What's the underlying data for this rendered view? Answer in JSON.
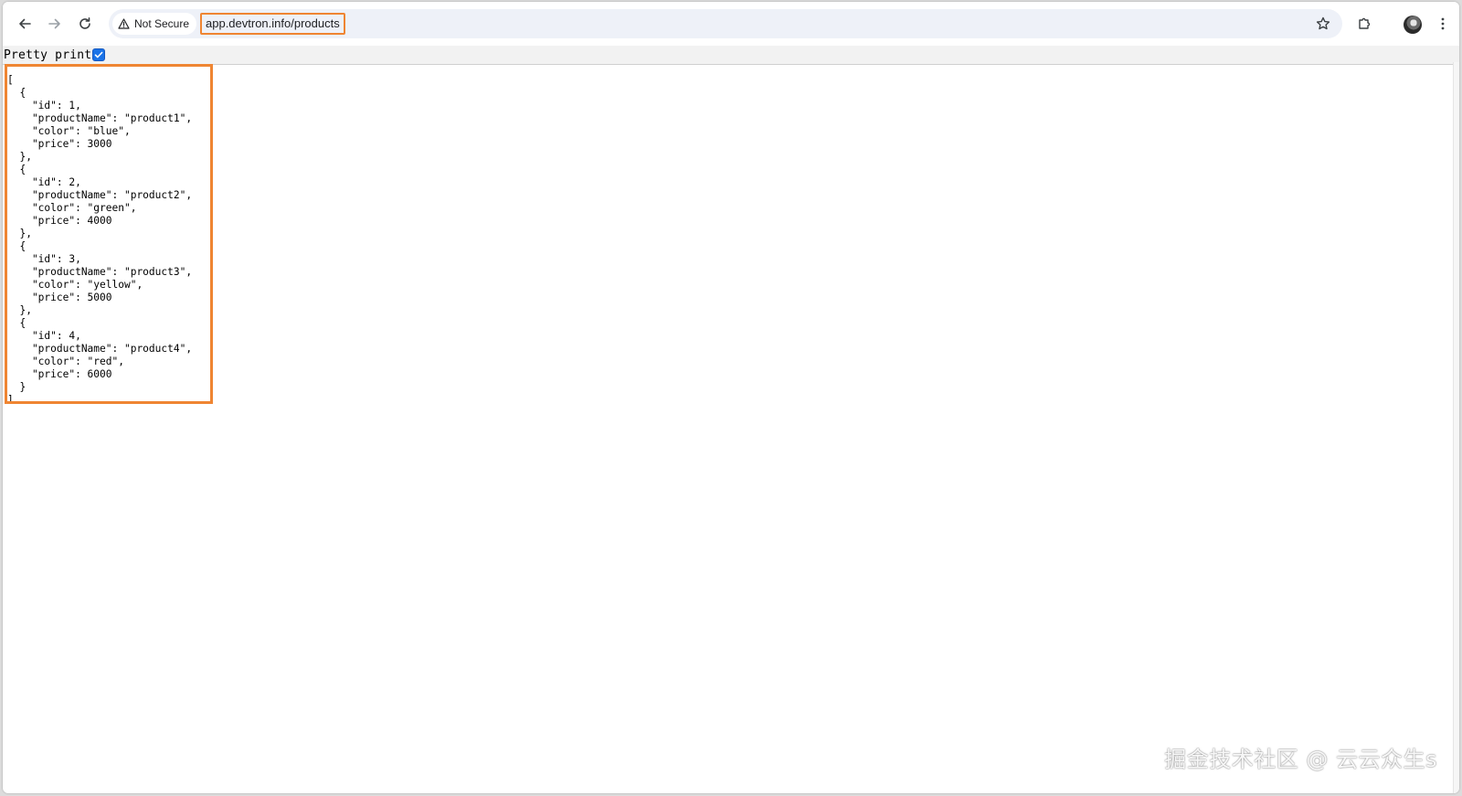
{
  "browser": {
    "security_label": "Not Secure",
    "url": "app.devtron.info/products",
    "icons": {
      "back": "arrow-left-icon",
      "forward": "arrow-right-icon",
      "reload": "reload-icon",
      "warning": "warning-triangle-icon",
      "bookmark": "star-icon",
      "extensions": "puzzle-icon",
      "profile": "avatar",
      "menu": "kebab-menu-icon"
    },
    "highlight_color": "#ef8532"
  },
  "viewer": {
    "pretty_print_label": "Pretty print",
    "pretty_print_checked": true,
    "json_lines": [
      "[",
      "  {",
      "    \"id\": 1,",
      "    \"productName\": \"product1\",",
      "    \"color\": \"blue\",",
      "    \"price\": 3000",
      "  },",
      "  {",
      "    \"id\": 2,",
      "    \"productName\": \"product2\",",
      "    \"color\": \"green\",",
      "    \"price\": 4000",
      "  },",
      "  {",
      "    \"id\": 3,",
      "    \"productName\": \"product3\",",
      "    \"color\": \"yellow\",",
      "    \"price\": 5000",
      "  },",
      "  {",
      "    \"id\": 4,",
      "    \"productName\": \"product4\",",
      "    \"color\": \"red\",",
      "    \"price\": 6000",
      "  }",
      "]"
    ]
  },
  "watermark": "掘金技术社区 @ 云云众生s"
}
